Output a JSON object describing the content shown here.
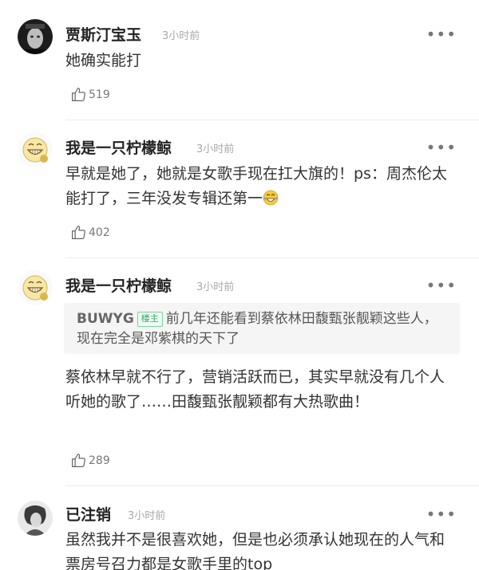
{
  "comments": [
    {
      "username": "贾斯汀宝玉",
      "time": "3小时前",
      "text": "她确实能打",
      "likes": "519",
      "avatar_icon": "dark-portrait-avatar"
    },
    {
      "username": "我是一只柠檬鲸",
      "time": "3小时前",
      "text": "早就是她了，她就是女歌手现在扛大旗的！ps：周杰伦太能打了，三年没发专辑还第一",
      "likes": "402",
      "avatar_icon": "laughing-cartoon-avatar",
      "emoji": "laughing-tears-emoji"
    },
    {
      "username": "我是一只柠檬鲸",
      "time": "3小时前",
      "quote": {
        "user": "BUWYG",
        "badge": "楼主",
        "text": "前几年还能看到蔡依林田馥甄张靓颖这些人，现在完全是邓紫棋的天下了"
      },
      "text": "蔡依林早就不行了，营销活跃而已，其实早就没有几个人听她的歌了……田馥甄张靓颖都有大热歌曲！",
      "likes": "289",
      "avatar_icon": "laughing-cartoon-avatar"
    },
    {
      "username": "已注销",
      "time": "3小时前",
      "text": "虽然我并不是很喜欢她，但是也必须承认她现在的人气和票房号召力都是女歌手里的top",
      "avatar_icon": "sketch-portrait-avatar"
    }
  ],
  "more_label": "•••"
}
